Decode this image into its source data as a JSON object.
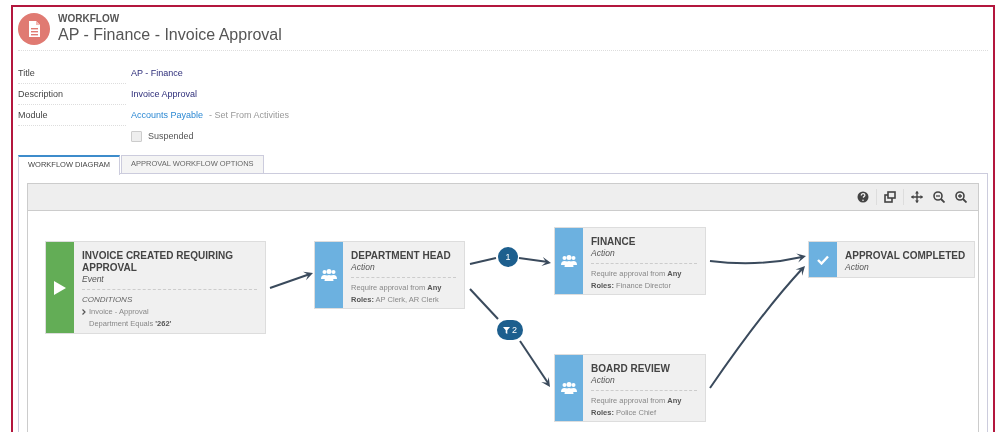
{
  "header": {
    "module": "WORKFLOW",
    "title": "AP - Finance - Invoice Approval"
  },
  "fields": [
    {
      "label": "Title",
      "value": "AP - Finance",
      "kind": "text"
    },
    {
      "label": "Description",
      "value": "Invoice Approval",
      "kind": "text"
    },
    {
      "label": "Module",
      "value": "Accounts Payable",
      "note": "-  Set From Activities",
      "kind": "link"
    }
  ],
  "suspended": {
    "label": "Suspended",
    "checked": false
  },
  "tabs": [
    {
      "label": "WORKFLOW DIAGRAM",
      "selected": true
    },
    {
      "label": "APPROVAL WORKFLOW OPTIONS",
      "selected": false
    }
  ],
  "diagram": {
    "nodes": [
      {
        "kind": "event",
        "title": "INVOICE CREATED REQUIRING APPROVAL",
        "type": "Event",
        "conditions_heading": "CONDITIONS",
        "condition": "Invoice - Approval",
        "condition_detail": "Department Equals **'262'**"
      },
      {
        "kind": "action",
        "title": "DEPARTMENT HEAD",
        "type": "Action",
        "lines": [
          "Require approval from **Any**",
          "**Roles:** AP Clerk, AR Clerk"
        ]
      },
      {
        "kind": "action",
        "title": "FINANCE",
        "type": "Action",
        "lines": [
          "Require approval from **Any**",
          "**Roles:** Finance Director"
        ]
      },
      {
        "kind": "action",
        "title": "BOARD REVIEW",
        "type": "Action",
        "lines": [
          "Require approval from **Any**",
          "**Roles:** Police Chief"
        ]
      },
      {
        "kind": "complete",
        "title": "APPROVAL COMPLETED",
        "type": "Action"
      }
    ],
    "badges": [
      {
        "label": "1",
        "kind": "plain"
      },
      {
        "label": "2",
        "kind": "filter"
      }
    ]
  }
}
